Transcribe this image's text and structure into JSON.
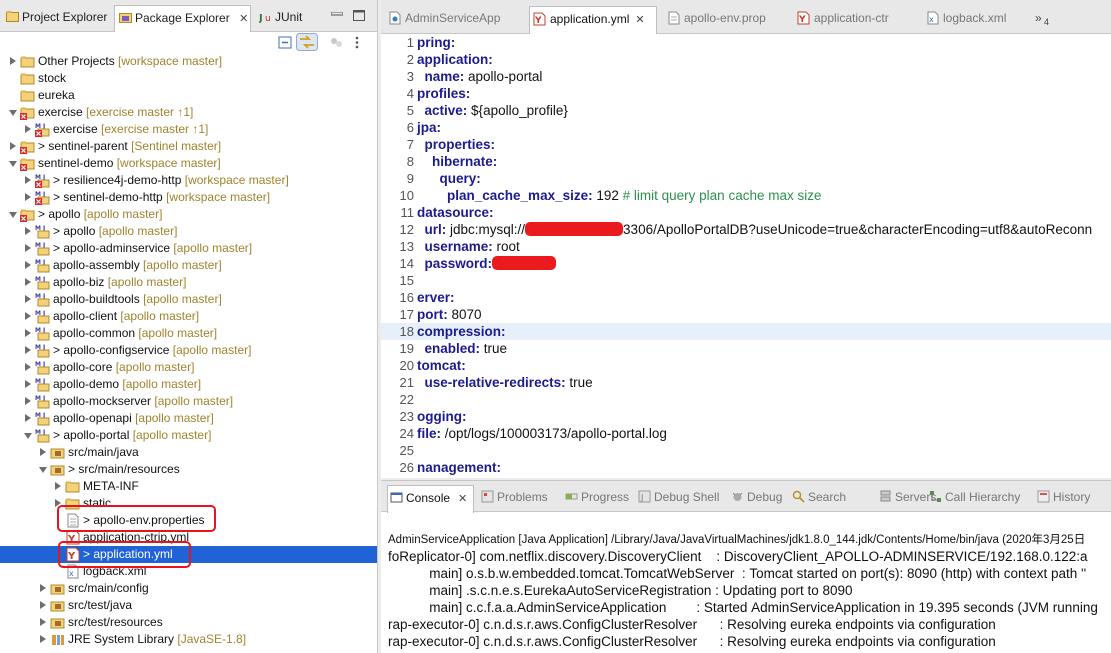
{
  "left_tabs": [
    {
      "label": "Project Explorer",
      "icon": "project-explorer-icon"
    },
    {
      "label": "Package Explorer",
      "icon": "package-explorer-icon",
      "close": "✕"
    },
    {
      "label": "JUnit",
      "icon": "junit-icon"
    }
  ],
  "tree": [
    {
      "label": "Other Projects",
      "dec": " [workspace master]",
      "icon": "working-set",
      "indent": 0,
      "tw": "r"
    },
    {
      "label": "stock",
      "dec": "",
      "icon": "project",
      "indent": 0,
      "tw": ""
    },
    {
      "label": "eureka",
      "dec": "",
      "icon": "project",
      "indent": 0,
      "tw": ""
    },
    {
      "label": "exercise",
      "dec": " [exercise master ↑1]",
      "icon": "project-error",
      "indent": 0,
      "tw": "d"
    },
    {
      "label": "exercise",
      "dec": " [exercise master ↑1]",
      "icon": "maven-error",
      "indent": 1,
      "tw": "r"
    },
    {
      "label": "> sentinel-parent",
      "dec": " [Sentinel master]",
      "icon": "project-error",
      "indent": 0,
      "tw": "r"
    },
    {
      "label": "sentinel-demo",
      "dec": " [workspace master]",
      "icon": "project-error",
      "indent": 0,
      "tw": "d"
    },
    {
      "label": "> resilience4j-demo-http",
      "dec": " [workspace master]",
      "icon": "maven-error",
      "indent": 1,
      "tw": "r"
    },
    {
      "label": "> sentinel-demo-http",
      "dec": " [workspace master]",
      "icon": "maven-error",
      "indent": 1,
      "tw": "r"
    },
    {
      "label": "> apollo",
      "dec": " [apollo master]",
      "icon": "project-error",
      "indent": 0,
      "tw": "d"
    },
    {
      "label": "> apollo",
      "dec": " [apollo master]",
      "icon": "maven",
      "indent": 1,
      "tw": "r"
    },
    {
      "label": "> apollo-adminservice",
      "dec": " [apollo master]",
      "icon": "maven",
      "indent": 1,
      "tw": "r"
    },
    {
      "label": "apollo-assembly",
      "dec": " [apollo master]",
      "icon": "maven",
      "indent": 1,
      "tw": "r"
    },
    {
      "label": "apollo-biz",
      "dec": " [apollo master]",
      "icon": "maven",
      "indent": 1,
      "tw": "r"
    },
    {
      "label": "apollo-buildtools",
      "dec": " [apollo master]",
      "icon": "maven",
      "indent": 1,
      "tw": "r"
    },
    {
      "label": "apollo-client",
      "dec": " [apollo master]",
      "icon": "maven",
      "indent": 1,
      "tw": "r"
    },
    {
      "label": "apollo-common",
      "dec": " [apollo master]",
      "icon": "maven",
      "indent": 1,
      "tw": "r"
    },
    {
      "label": "> apollo-configservice",
      "dec": " [apollo master]",
      "icon": "maven",
      "indent": 1,
      "tw": "r"
    },
    {
      "label": "apollo-core",
      "dec": " [apollo master]",
      "icon": "maven",
      "indent": 1,
      "tw": "r"
    },
    {
      "label": "apollo-demo",
      "dec": " [apollo master]",
      "icon": "maven",
      "indent": 1,
      "tw": "r"
    },
    {
      "label": "apollo-mockserver",
      "dec": " [apollo master]",
      "icon": "maven",
      "indent": 1,
      "tw": "r"
    },
    {
      "label": "apollo-openapi",
      "dec": " [apollo master]",
      "icon": "maven",
      "indent": 1,
      "tw": "r"
    },
    {
      "label": "> apollo-portal",
      "dec": " [apollo master]",
      "icon": "maven",
      "indent": 1,
      "tw": "d"
    },
    {
      "label": "src/main/java",
      "dec": "",
      "icon": "src-folder",
      "indent": 2,
      "tw": "r"
    },
    {
      "label": "> src/main/resources",
      "dec": "",
      "icon": "src-folder",
      "indent": 2,
      "tw": "d"
    },
    {
      "label": "META-INF",
      "dec": "",
      "icon": "folder",
      "indent": 3,
      "tw": "r"
    },
    {
      "label": "static",
      "dec": "",
      "icon": "folder",
      "indent": 3,
      "tw": "r"
    },
    {
      "label": "> apollo-env.properties",
      "dec": "",
      "icon": "properties-file",
      "indent": 3,
      "tw": ""
    },
    {
      "label": "application-ctrip.yml",
      "dec": "",
      "icon": "yml-file",
      "indent": 3,
      "tw": ""
    },
    {
      "label": "> application.yml",
      "dec": "",
      "icon": "yml-file",
      "indent": 3,
      "tw": "",
      "selected": true
    },
    {
      "label": "logback.xml",
      "dec": "",
      "icon": "xml-file",
      "indent": 3,
      "tw": ""
    },
    {
      "label": "src/main/config",
      "dec": "",
      "icon": "src-folder",
      "indent": 2,
      "tw": "r"
    },
    {
      "label": "src/test/java",
      "dec": "",
      "icon": "src-folder",
      "indent": 2,
      "tw": "r"
    },
    {
      "label": "src/test/resources",
      "dec": "",
      "icon": "src-folder",
      "indent": 2,
      "tw": "r"
    },
    {
      "label": "JRE System Library",
      "dec": " [JavaSE-1.8]",
      "icon": "library",
      "indent": 2,
      "tw": "r"
    }
  ],
  "editor_tabs": [
    {
      "label": "AdminServiceApp",
      "icon": "java-file-icon"
    },
    {
      "label": "application.yml",
      "icon": "yml-file-icon",
      "close": "✕",
      "active": true
    },
    {
      "label": "apollo-env.prop",
      "icon": "properties-file-icon"
    },
    {
      "label": "application-ctr",
      "icon": "yml-file-icon"
    },
    {
      "label": "logback.xml",
      "icon": "xml-file-icon"
    },
    {
      "label": "»",
      "icon": ""
    },
    {
      "label": "4",
      "icon": ""
    }
  ],
  "code_lines": [
    {
      "n": "1",
      "parts": [
        [
          "k",
          "pring:"
        ]
      ]
    },
    {
      "n": "2",
      "parts": [
        [
          "k",
          "application:"
        ]
      ]
    },
    {
      "n": "3",
      "parts": [
        [
          "v",
          "  "
        ],
        [
          "k",
          "name:"
        ],
        [
          "v",
          " apollo-portal"
        ]
      ]
    },
    {
      "n": "4",
      "parts": [
        [
          "k",
          "profiles:"
        ]
      ]
    },
    {
      "n": "5",
      "parts": [
        [
          "v",
          "  "
        ],
        [
          "k",
          "active:"
        ],
        [
          "v",
          " ${apollo_profile}"
        ]
      ]
    },
    {
      "n": "6",
      "parts": [
        [
          "k",
          "jpa:"
        ]
      ]
    },
    {
      "n": "7",
      "parts": [
        [
          "v",
          "  "
        ],
        [
          "k",
          "properties:"
        ]
      ]
    },
    {
      "n": "8",
      "parts": [
        [
          "v",
          "    "
        ],
        [
          "k",
          "hibernate:"
        ]
      ]
    },
    {
      "n": "9",
      "parts": [
        [
          "v",
          "      "
        ],
        [
          "k",
          "query:"
        ]
      ]
    },
    {
      "n": "10",
      "parts": [
        [
          "v",
          "        "
        ],
        [
          "k",
          "plan_cache_max_size:"
        ],
        [
          "v",
          " 192 "
        ],
        [
          "cm",
          "# limit query plan cache max size"
        ]
      ]
    },
    {
      "n": "11",
      "parts": [
        [
          "k",
          "datasource:"
        ]
      ]
    },
    {
      "n": "12",
      "parts": [
        [
          "v",
          "  "
        ],
        [
          "k",
          "url:"
        ],
        [
          "v",
          " jdbc:mysql://"
        ],
        [
          "redact",
          "98"
        ],
        [
          "v",
          "3306/ApolloPortalDB?useUnicode=true&characterEncoding=utf8&autoReconn"
        ]
      ]
    },
    {
      "n": "13",
      "parts": [
        [
          "v",
          "  "
        ],
        [
          "k",
          "username:"
        ],
        [
          "v",
          " root"
        ]
      ]
    },
    {
      "n": "14",
      "parts": [
        [
          "v",
          "  "
        ],
        [
          "k",
          "password:"
        ],
        [
          "redact",
          "64"
        ]
      ]
    },
    {
      "n": "15",
      "parts": []
    },
    {
      "n": "16",
      "parts": [
        [
          "k",
          "erver:"
        ]
      ]
    },
    {
      "n": "17",
      "parts": [
        [
          "k",
          "port:"
        ],
        [
          "v",
          " 8070"
        ]
      ]
    },
    {
      "n": "18",
      "parts": [
        [
          "k",
          "compression:"
        ]
      ],
      "hl": true
    },
    {
      "n": "19",
      "parts": [
        [
          "v",
          "  "
        ],
        [
          "k",
          "enabled:"
        ],
        [
          "v",
          " true"
        ]
      ]
    },
    {
      "n": "20",
      "parts": [
        [
          "k",
          "tomcat:"
        ]
      ]
    },
    {
      "n": "21",
      "parts": [
        [
          "v",
          "  "
        ],
        [
          "k",
          "use-relative-redirects:"
        ],
        [
          "v",
          " true"
        ]
      ]
    },
    {
      "n": "22",
      "parts": []
    },
    {
      "n": "23",
      "parts": [
        [
          "k",
          "ogging:"
        ]
      ]
    },
    {
      "n": "24",
      "parts": [
        [
          "k",
          "file:"
        ],
        [
          "v",
          " /opt/logs/100003173/apollo-portal.log"
        ]
      ]
    },
    {
      "n": "25",
      "parts": []
    },
    {
      "n": "26",
      "parts": [
        [
          "k",
          "nanagement:"
        ]
      ]
    }
  ],
  "console_tabs": [
    {
      "label": "Console",
      "icon": "console-icon",
      "close": "✕",
      "active": true
    },
    {
      "label": "Problems",
      "icon": "problems-icon"
    },
    {
      "label": "Progress",
      "icon": "progress-icon"
    },
    {
      "label": "Debug Shell",
      "icon": "debug-shell-icon"
    },
    {
      "label": "Debug",
      "icon": "debug-icon"
    },
    {
      "label": "Search",
      "icon": "search-icon"
    },
    {
      "label": "Servers",
      "icon": "servers-icon"
    },
    {
      "label": "Call Hierarchy",
      "icon": "call-hierarchy-icon"
    },
    {
      "label": "History",
      "icon": "history-icon"
    }
  ],
  "console_title": "AdminServiceApplication [Java Application] /Library/Java/JavaVirtualMachines/jdk1.8.0_144.jdk/Contents/Home/bin/java (2020年3月25日",
  "console_lines": [
    "foReplicator-0] com.netflix.discovery.DiscoveryClient    : DiscoveryClient_APOLLO-ADMINSERVICE/192.168.0.122:a",
    "           main] o.s.b.w.embedded.tomcat.TomcatWebServer  : Tomcat started on port(s): 8090 (http) with context path ''",
    "           main] .s.c.n.e.s.EurekaAutoServiceRegistration : Updating port to 8090",
    "           main] c.c.f.a.a.AdminServiceApplication        : Started AdminServiceApplication in 19.395 seconds (JVM running",
    "rap-executor-0] c.n.d.s.r.aws.ConfigClusterResolver      : Resolving eureka endpoints via configuration",
    "rap-executor-0] c.n.d.s.r.aws.ConfigClusterResolver      : Resolving eureka endpoints via configuration"
  ],
  "colors": {
    "selection": "#1f63d6",
    "highlight_box": "#e8141c",
    "keyword": "#1b1b8f",
    "comment": "#2f8f4e",
    "decoration": "#a0832f"
  }
}
